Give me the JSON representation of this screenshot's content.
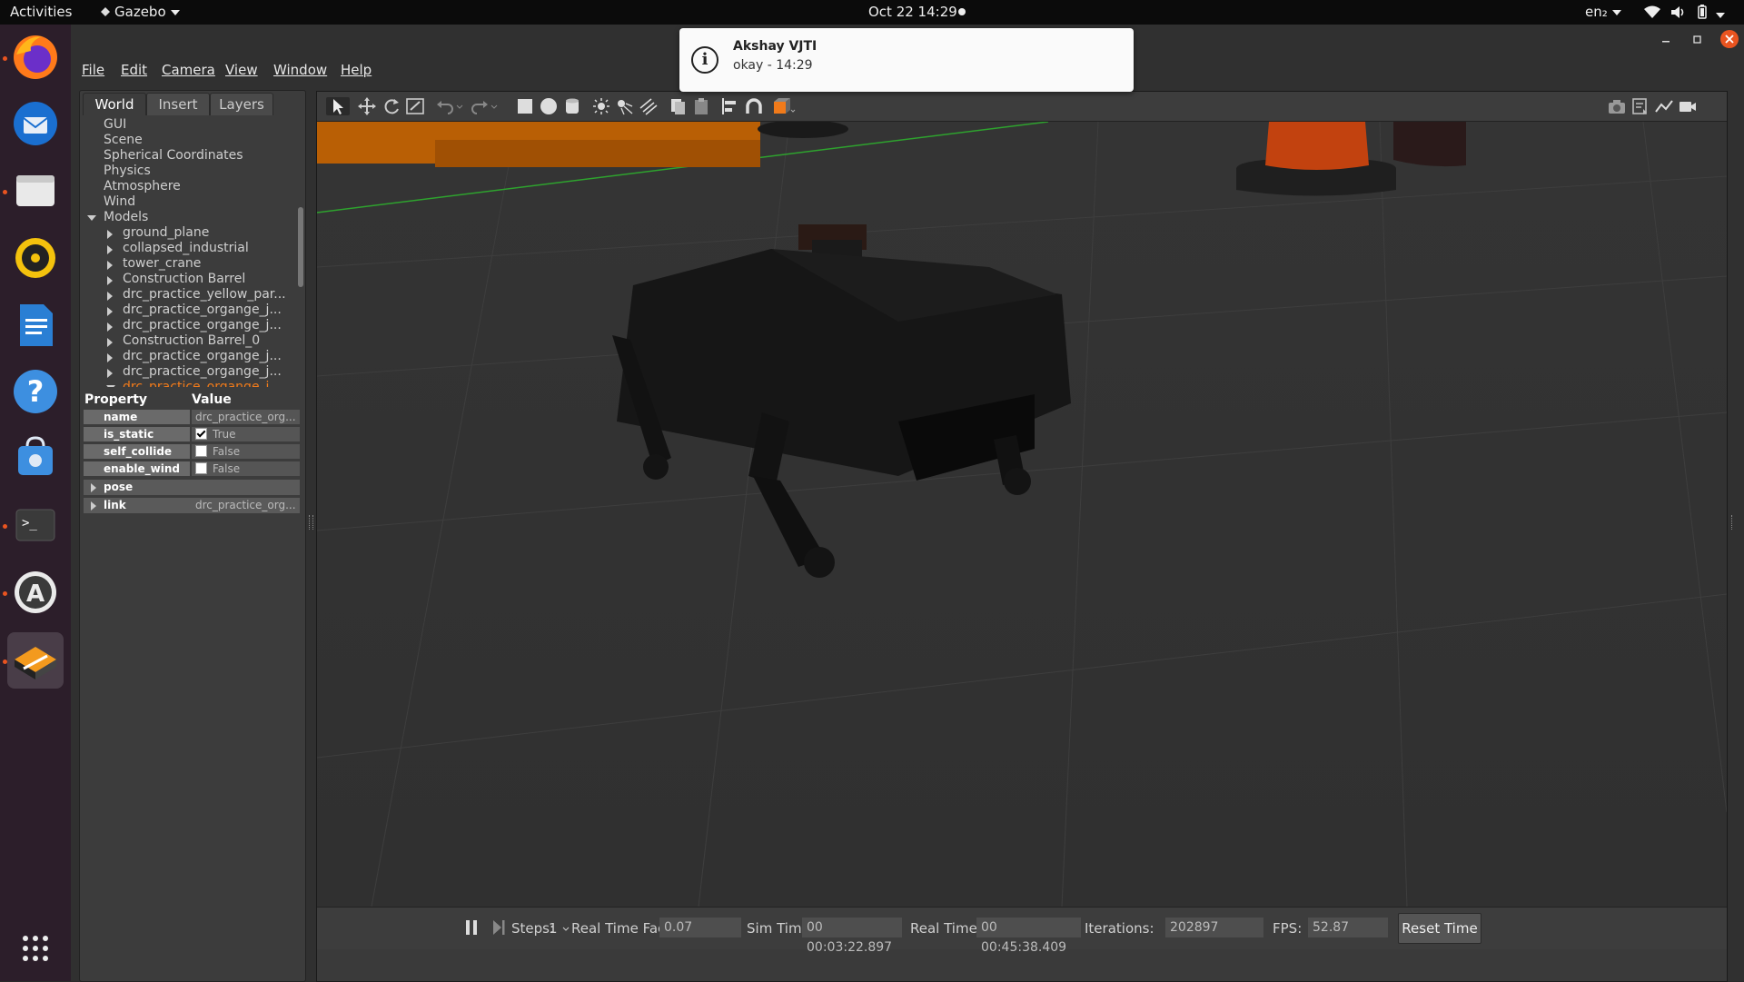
{
  "topbar": {
    "activities": "Activities",
    "app_name": "Gazebo",
    "datetime": "Oct 22  14:29",
    "input_lang": "en₂"
  },
  "notification": {
    "title": "Akshay VJTI",
    "body": "okay - 14:29",
    "icon": "info-icon"
  },
  "dock": {
    "apps": [
      {
        "name": "firefox-icon",
        "running": true
      },
      {
        "name": "thunderbird-icon",
        "running": false
      },
      {
        "name": "files-icon",
        "running": true
      },
      {
        "name": "rhythmbox-icon",
        "running": false
      },
      {
        "name": "writer-icon",
        "running": false
      },
      {
        "name": "help-icon",
        "running": false
      },
      {
        "name": "software-store-icon",
        "running": false
      },
      {
        "name": "terminal-icon",
        "running": true
      },
      {
        "name": "software-updater-icon",
        "running": true
      },
      {
        "name": "gazebo-icon",
        "running": true
      }
    ],
    "show_apps": "app-grid-icon"
  },
  "menubar": [
    "File",
    "Edit",
    "Camera",
    "View",
    "Window",
    "Help"
  ],
  "left_panel": {
    "tabs": [
      "World",
      "Insert",
      "Layers"
    ],
    "active_tab": "World",
    "tree_top": [
      "GUI",
      "Scene",
      "Spherical Coordinates",
      "Physics",
      "Atmosphere",
      "Wind"
    ],
    "models_label": "Models",
    "models": [
      "ground_plane",
      "collapsed_industrial",
      "tower_crane",
      "Construction Barrel",
      "drc_practice_yellow_par...",
      "drc_practice_organge_j...",
      "drc_practice_organge_j...",
      "Construction Barrel_0",
      "drc_practice_organge_j...",
      "drc_practice_organge_j..."
    ],
    "selected_model": "drc_practice_organge_j...",
    "properties": {
      "header_property": "Property",
      "header_value": "Value",
      "rows": [
        {
          "key": "name",
          "value": "drc_practice_org..."
        },
        {
          "key": "is_static",
          "value": "True",
          "checked": true
        },
        {
          "key": "self_collide",
          "value": "False",
          "checked": false
        },
        {
          "key": "enable_wind",
          "value": "False",
          "checked": false
        },
        {
          "key": "pose",
          "value": ""
        },
        {
          "key": "link",
          "value": "drc_practice_org..."
        }
      ]
    }
  },
  "bottombar": {
    "steps_label": "Steps:",
    "steps_value": "1",
    "rtf_label": "Real Time Factor:",
    "rtf_value": "0.07",
    "sim_time_label": "Sim Time:",
    "sim_time_value": "00 00:03:22.897",
    "real_time_label": "Real Time:",
    "real_time_value": "00 00:45:38.409",
    "iterations_label": "Iterations:",
    "iterations_value": "202897",
    "fps_label": "FPS:",
    "fps_value": "52.87",
    "reset_label": "Reset Time"
  },
  "colors": {
    "accent": "#e95420",
    "selected_tree": "#f07a1a",
    "dock_bg": "#2c1e2a"
  }
}
